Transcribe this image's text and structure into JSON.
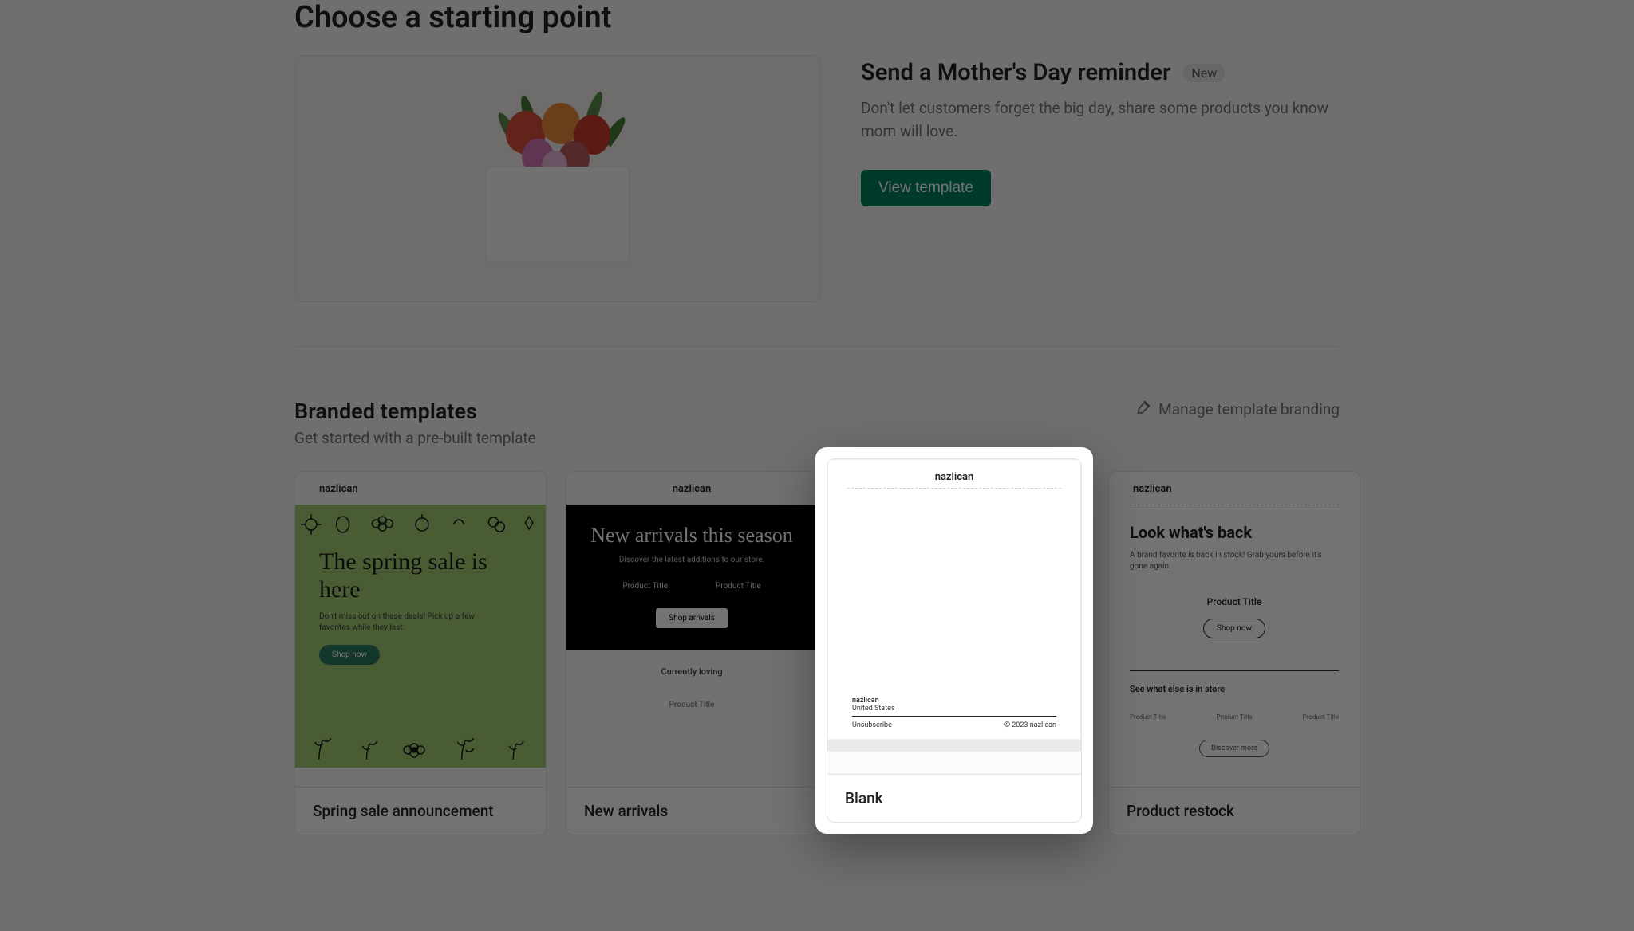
{
  "page": {
    "title": "Choose a starting point"
  },
  "hero": {
    "heading": "Send a Mother's Day reminder",
    "badge": "New",
    "description": "Don't let customers forget the big day, share some products you know mom will love.",
    "button": "View template"
  },
  "branded": {
    "title": "Branded templates",
    "subtitle": "Get started with a pre-built template",
    "manage_label": "Manage template branding"
  },
  "templates": {
    "spring": {
      "name": "Spring sale announcement",
      "brand": "nazlican",
      "headline": "The spring sale is here",
      "body": "Don't miss out on these deals! Pick up a few favorites while they last.",
      "cta": "Shop now"
    },
    "arrivals": {
      "name": "New arrivals",
      "brand": "nazlican",
      "headline": "New arrivals this season",
      "body": "Discover the latest additions to our store.",
      "col1": "Product Title",
      "col2": "Product Title",
      "cta": "Shop arrivals",
      "loving": "Currently loving",
      "loving_p": "Product Title"
    },
    "blank": {
      "name": "Blank",
      "brand": "nazlican",
      "footer_brand": "nazlican",
      "footer_loc": "United States",
      "unsubscribe": "Unsubscribe",
      "copyright": "© 2023 nazlican"
    },
    "restock": {
      "name": "Product restock",
      "brand": "nazlican",
      "headline": "Look what's back",
      "body": "A brand favorite is back in stock! Grab yours before it's gone again.",
      "product": "Product Title",
      "cta": "Shop now",
      "see": "See what else is in store",
      "mini1": "Product Title",
      "mini2": "Product Title",
      "mini3": "Product Title",
      "cta2": "Discover more"
    }
  }
}
